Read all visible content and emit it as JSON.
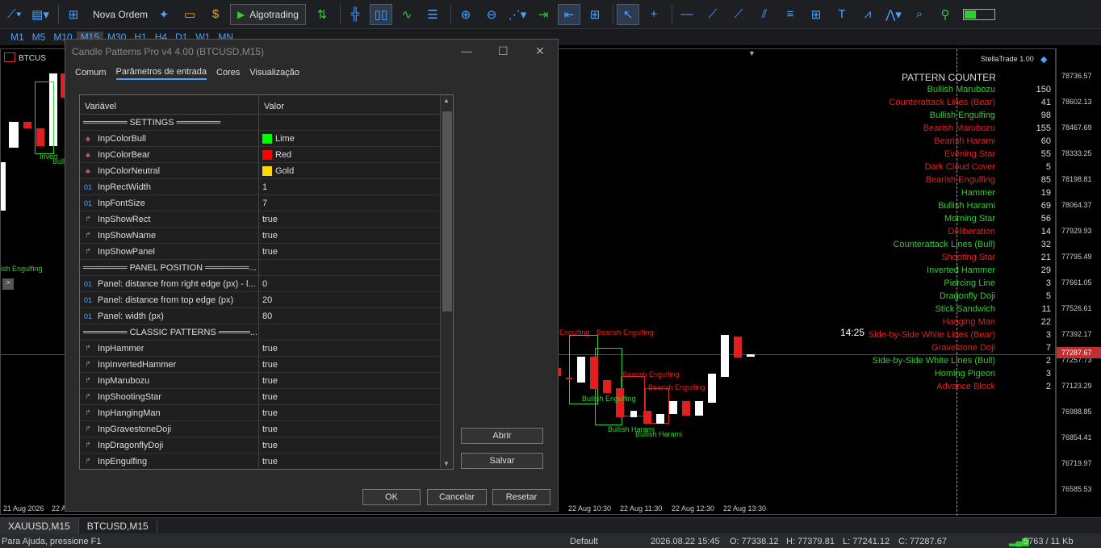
{
  "toolbar": {
    "nova_ordem": "Nova Ordem",
    "algotrading": "Algotrading"
  },
  "timeframes": [
    "M1",
    "M5",
    "M10",
    "M15",
    "M30",
    "H1",
    "H4",
    "D1",
    "W1",
    "MN"
  ],
  "chart": {
    "symbol_left": "BTCUS",
    "broker": "StellaTrade 1.00",
    "clock": "14:25",
    "time_labels": [
      "21 Aug 2026",
      "22 A",
      "22 Aug 10:30",
      "22 Aug 11:30",
      "22 Aug 12:30",
      "22 Aug 13:30"
    ],
    "price_labels": [
      "78736.57",
      "78602.13",
      "78467.69",
      "78333.25",
      "78198.81",
      "78064.37",
      "77929.93",
      "77795.49",
      "77661.05",
      "77526.61",
      "77392.17",
      "77257.73",
      "77123.29",
      "76988.85",
      "76854.41",
      "76719.97",
      "76585.53"
    ],
    "current_price": "77287.67",
    "left_labels": {
      "inverted": "Invert",
      "bull_engulf_left": "ish Engulfing",
      "bull": "Bull"
    },
    "pattern_labels": [
      "Engulfing",
      "Bearish Engulfing",
      "Bearish Engulfing",
      "Bearish Engulfing",
      "Bullish Engulfing",
      "Bullish Harami",
      "Bullish Harami"
    ]
  },
  "counter": {
    "title": "PATTERN COUNTER",
    "items": [
      {
        "name": "Bullish Marubozu",
        "count": "150",
        "color": "#32cd32"
      },
      {
        "name": "Counterattack Lines (Bear)",
        "count": "41",
        "color": "#e02020"
      },
      {
        "name": "Bullish Engulfing",
        "count": "98",
        "color": "#32cd32"
      },
      {
        "name": "Bearish Marubozu",
        "count": "155",
        "color": "#e02020"
      },
      {
        "name": "Bearish Harami",
        "count": "60",
        "color": "#e02020"
      },
      {
        "name": "Evening Star",
        "count": "55",
        "color": "#e02020"
      },
      {
        "name": "Dark Cloud Cover",
        "count": "5",
        "color": "#e02020"
      },
      {
        "name": "Bearish Engulfing",
        "count": "85",
        "color": "#e02020"
      },
      {
        "name": "Hammer",
        "count": "19",
        "color": "#32cd32"
      },
      {
        "name": "Bullish Harami",
        "count": "69",
        "color": "#32cd32"
      },
      {
        "name": "Morning Star",
        "count": "56",
        "color": "#32cd32"
      },
      {
        "name": "Deliberation",
        "count": "14",
        "color": "#e02020"
      },
      {
        "name": "Counterattack Lines (Bull)",
        "count": "32",
        "color": "#32cd32"
      },
      {
        "name": "Shooting Star",
        "count": "21",
        "color": "#e02020"
      },
      {
        "name": "Inverted Hammer",
        "count": "29",
        "color": "#32cd32"
      },
      {
        "name": "Piercing Line",
        "count": "3",
        "color": "#32cd32"
      },
      {
        "name": "Dragonfly Doji",
        "count": "5",
        "color": "#32cd32"
      },
      {
        "name": "Stick Sandwich",
        "count": "11",
        "color": "#32cd32"
      },
      {
        "name": "Hanging Man",
        "count": "22",
        "color": "#e02020"
      },
      {
        "name": "Side-by-Side White Lines (Bear)",
        "count": "3",
        "color": "#e02020"
      },
      {
        "name": "Gravestone Doji",
        "count": "7",
        "color": "#e02020"
      },
      {
        "name": "Side-by-Side White Lines (Bull)",
        "count": "2",
        "color": "#32cd32"
      },
      {
        "name": "Homing Pigeon",
        "count": "3",
        "color": "#32cd32"
      },
      {
        "name": "Advance Block",
        "count": "2",
        "color": "#e02020"
      }
    ]
  },
  "dialog": {
    "title": "Candle Patterns Pro v4 4.00 (BTCUSD,M15)",
    "tabs": [
      "Comum",
      "Parâmetros de entrada",
      "Cores",
      "Visualização"
    ],
    "col_var": "Variável",
    "col_val": "Valor",
    "rows": [
      {
        "type": "sec",
        "name": "═══════ SETTINGS ═══════",
        "value": ""
      },
      {
        "type": "color",
        "name": "InpColorBull",
        "value": "Lime",
        "swatch": "#00ff00"
      },
      {
        "type": "color",
        "name": "InpColorBear",
        "value": "Red",
        "swatch": "#ff0000"
      },
      {
        "type": "color",
        "name": "InpColorNeutral",
        "value": "Gold",
        "swatch": "#ffd700"
      },
      {
        "type": "int",
        "name": "InpRectWidth",
        "value": "1"
      },
      {
        "type": "int",
        "name": "InpFontSize",
        "value": "7"
      },
      {
        "type": "bool",
        "name": "InpShowRect",
        "value": "true"
      },
      {
        "type": "bool",
        "name": "InpShowName",
        "value": "true"
      },
      {
        "type": "bool",
        "name": "InpShowPanel",
        "value": "true"
      },
      {
        "type": "sec",
        "name": "═══════ PANEL POSITION ═══════...",
        "value": ""
      },
      {
        "type": "int",
        "name": "Panel: distance from right edge (px) - l...",
        "value": "0"
      },
      {
        "type": "int",
        "name": "Panel: distance from top edge (px)",
        "value": "20"
      },
      {
        "type": "int",
        "name": "Panel: width (px)",
        "value": "80"
      },
      {
        "type": "sec",
        "name": "═══════ CLASSIC PATTERNS ═════...",
        "value": ""
      },
      {
        "type": "bool",
        "name": "InpHammer",
        "value": "true"
      },
      {
        "type": "bool",
        "name": "InpInvertedHammer",
        "value": "true"
      },
      {
        "type": "bool",
        "name": "InpMarubozu",
        "value": "true"
      },
      {
        "type": "bool",
        "name": "InpShootingStar",
        "value": "true"
      },
      {
        "type": "bool",
        "name": "InpHangingMan",
        "value": "true"
      },
      {
        "type": "bool",
        "name": "InpGravestoneDoji",
        "value": "true"
      },
      {
        "type": "bool",
        "name": "InpDragonflyDoji",
        "value": "true"
      },
      {
        "type": "bool",
        "name": "InpEngulfing",
        "value": "true"
      }
    ],
    "abrir": "Abrir",
    "salvar": "Salvar",
    "ok": "OK",
    "cancelar": "Cancelar",
    "resetar": "Resetar"
  },
  "bottom_tabs": [
    "XAUUSD,M15",
    "BTCUSD,M15"
  ],
  "status": {
    "help": "Para Ajuda, pressione F1",
    "profile": "Default",
    "datetime": "2026.08.22 15:45",
    "open": "O: 77338.12",
    "high": "H: 77379.81",
    "low": "L: 77241.12",
    "close": "C: 77287.67",
    "traffic": "5763 / 11 Kb"
  }
}
